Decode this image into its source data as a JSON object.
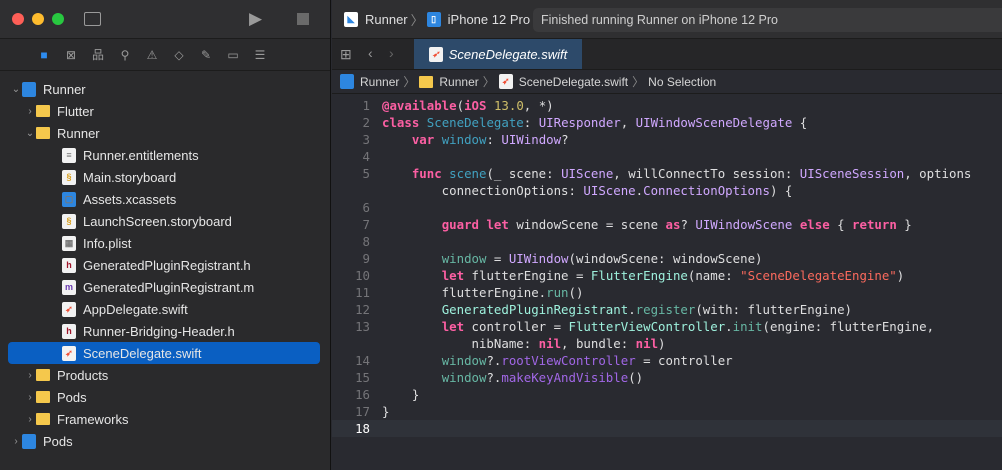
{
  "toolbar": {
    "scheme": "Runner",
    "device": "iPhone 12 Pro",
    "status": "Finished running Runner on iPhone 12 Pro"
  },
  "editor_tab": "SceneDelegate.swift",
  "breadcrumb": [
    "Runner",
    "Runner",
    "SceneDelegate.swift",
    "No Selection"
  ],
  "tree": [
    {
      "label": "Runner",
      "level": 0,
      "chev": "v",
      "icon": "proj"
    },
    {
      "label": "Flutter",
      "level": 1,
      "chev": ">",
      "icon": "folder"
    },
    {
      "label": "Runner",
      "level": 1,
      "chev": "v",
      "icon": "folder"
    },
    {
      "label": "Runner.entitlements",
      "level": 2,
      "icon": "file",
      "glyph": "≡"
    },
    {
      "label": "Main.storyboard",
      "level": 2,
      "icon": "file",
      "glyph": "§"
    },
    {
      "label": "Assets.xcassets",
      "level": 2,
      "icon": "proj",
      "glyph": "▢"
    },
    {
      "label": "LaunchScreen.storyboard",
      "level": 2,
      "icon": "file",
      "glyph": "§"
    },
    {
      "label": "Info.plist",
      "level": 2,
      "icon": "file",
      "glyph": "▦"
    },
    {
      "label": "GeneratedPluginRegistrant.h",
      "level": 2,
      "icon": "file",
      "glyph": "h"
    },
    {
      "label": "GeneratedPluginRegistrant.m",
      "level": 2,
      "icon": "file",
      "glyph": "m"
    },
    {
      "label": "AppDelegate.swift",
      "level": 2,
      "icon": "file",
      "glyph": "➶"
    },
    {
      "label": "Runner-Bridging-Header.h",
      "level": 2,
      "icon": "file",
      "glyph": "h"
    },
    {
      "label": "SceneDelegate.swift",
      "level": 2,
      "icon": "file",
      "glyph": "➶",
      "selected": true
    },
    {
      "label": "Products",
      "level": 1,
      "chev": ">",
      "icon": "folder"
    },
    {
      "label": "Pods",
      "level": 1,
      "chev": ">",
      "icon": "folder"
    },
    {
      "label": "Frameworks",
      "level": 1,
      "chev": ">",
      "icon": "folder"
    },
    {
      "label": "Pods",
      "level": 0,
      "chev": ">",
      "icon": "proj"
    }
  ],
  "code": [
    {
      "n": "1",
      "t": [
        [
          "@available",
          "k"
        ],
        [
          "(",
          "pl"
        ],
        [
          "iOS",
          "k"
        ],
        [
          " ",
          "pl"
        ],
        [
          "13.0",
          "n"
        ],
        [
          ", *)",
          "pl"
        ]
      ]
    },
    {
      "n": "2",
      "t": [
        [
          "class",
          "k"
        ],
        [
          " ",
          "pl"
        ],
        [
          "SceneDelegate",
          "d"
        ],
        [
          ": ",
          "pl"
        ],
        [
          "UIResponder",
          "t"
        ],
        [
          ", ",
          "pl"
        ],
        [
          "UIWindowSceneDelegate",
          "t"
        ],
        [
          " {",
          "pl"
        ]
      ]
    },
    {
      "n": "3",
      "t": [
        [
          "    ",
          "pl"
        ],
        [
          "var",
          "k"
        ],
        [
          " ",
          "pl"
        ],
        [
          "window",
          "d"
        ],
        [
          ": ",
          "pl"
        ],
        [
          "UIWindow",
          "t"
        ],
        [
          "?",
          "pl"
        ]
      ]
    },
    {
      "n": "4",
      "t": []
    },
    {
      "n": "5",
      "t": [
        [
          "    ",
          "pl"
        ],
        [
          "func",
          "k"
        ],
        [
          " ",
          "pl"
        ],
        [
          "scene",
          "d"
        ],
        [
          "(_ scene: ",
          "pl"
        ],
        [
          "UIScene",
          "t"
        ],
        [
          ", willConnectTo session: ",
          "pl"
        ],
        [
          "UISceneSession",
          "t"
        ],
        [
          ", options",
          "pl"
        ]
      ]
    },
    {
      "n": "",
      "t": [
        [
          "        connectionOptions: ",
          "pl"
        ],
        [
          "UIScene",
          "t"
        ],
        [
          ".",
          "pl"
        ],
        [
          "ConnectionOptions",
          "t"
        ],
        [
          ") {",
          "pl"
        ]
      ]
    },
    {
      "n": "6",
      "t": []
    },
    {
      "n": "7",
      "t": [
        [
          "        ",
          "pl"
        ],
        [
          "guard",
          "k"
        ],
        [
          " ",
          "pl"
        ],
        [
          "let",
          "k"
        ],
        [
          " windowScene = scene ",
          "pl"
        ],
        [
          "as",
          "k"
        ],
        [
          "? ",
          "pl"
        ],
        [
          "UIWindowScene",
          "t"
        ],
        [
          " ",
          "pl"
        ],
        [
          "else",
          "k"
        ],
        [
          " { ",
          "pl"
        ],
        [
          "return",
          "k"
        ],
        [
          " }",
          "pl"
        ]
      ]
    },
    {
      "n": "8",
      "t": []
    },
    {
      "n": "9",
      "t": [
        [
          "        ",
          "pl"
        ],
        [
          "window",
          "p"
        ],
        [
          " = ",
          "pl"
        ],
        [
          "UIWindow",
          "t"
        ],
        [
          "(windowScene: windowScene)",
          "pl"
        ]
      ]
    },
    {
      "n": "10",
      "t": [
        [
          "        ",
          "pl"
        ],
        [
          "let",
          "k"
        ],
        [
          " flutterEngine = ",
          "pl"
        ],
        [
          "FlutterEngine",
          "pt"
        ],
        [
          "(name: ",
          "pl"
        ],
        [
          "\"SceneDelegateEngine\"",
          "s"
        ],
        [
          ")",
          "pl"
        ]
      ]
    },
    {
      "n": "11",
      "t": [
        [
          "        flutterEngine.",
          "pl"
        ],
        [
          "run",
          "p"
        ],
        [
          "()",
          "pl"
        ]
      ]
    },
    {
      "n": "12",
      "t": [
        [
          "        ",
          "pl"
        ],
        [
          "GeneratedPluginRegistrant",
          "pt"
        ],
        [
          ".",
          "pl"
        ],
        [
          "register",
          "p"
        ],
        [
          "(with: flutterEngine)",
          "pl"
        ]
      ]
    },
    {
      "n": "13",
      "t": [
        [
          "        ",
          "pl"
        ],
        [
          "let",
          "k"
        ],
        [
          " controller = ",
          "pl"
        ],
        [
          "FlutterViewController",
          "pt"
        ],
        [
          ".",
          "pl"
        ],
        [
          "init",
          "p"
        ],
        [
          "(engine: flutterEngine,",
          "pl"
        ]
      ]
    },
    {
      "n": "",
      "t": [
        [
          "            nibName: ",
          "pl"
        ],
        [
          "nil",
          "k"
        ],
        [
          ", bundle: ",
          "pl"
        ],
        [
          "nil",
          "k"
        ],
        [
          ")",
          "pl"
        ]
      ]
    },
    {
      "n": "14",
      "t": [
        [
          "        ",
          "pl"
        ],
        [
          "window",
          "p"
        ],
        [
          "?.",
          "pl"
        ],
        [
          "rootViewController",
          "f"
        ],
        [
          " = controller",
          "pl"
        ]
      ]
    },
    {
      "n": "15",
      "t": [
        [
          "        ",
          "pl"
        ],
        [
          "window",
          "p"
        ],
        [
          "?.",
          "pl"
        ],
        [
          "makeKeyAndVisible",
          "f"
        ],
        [
          "()",
          "pl"
        ]
      ]
    },
    {
      "n": "16",
      "t": [
        [
          "    }",
          "pl"
        ]
      ]
    },
    {
      "n": "17",
      "t": [
        [
          "}",
          "pl"
        ]
      ]
    },
    {
      "n": "18",
      "t": [],
      "current": true
    }
  ]
}
